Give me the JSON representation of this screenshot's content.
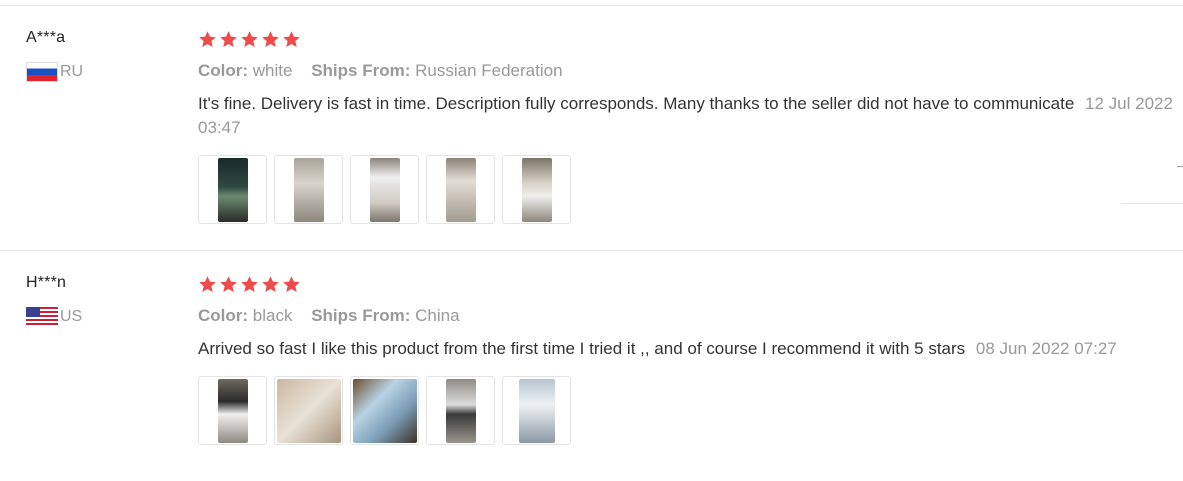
{
  "reviews": [
    {
      "user": "A***a",
      "country": "RU",
      "flag": "russia-flag",
      "rating": 5,
      "color_label": "Color:",
      "color_value": "white",
      "ships_label": "Ships From:",
      "ships_value": "Russian Federation",
      "text": "It's fine. Delivery is fast in time. Description fully corresponds. Many thanks to the seller did not have to communicate",
      "date": "12 Jul 2022 03:47",
      "photos": 5
    },
    {
      "user": "H***n",
      "country": "US",
      "flag": "usa-flag",
      "rating": 5,
      "color_label": "Color:",
      "color_value": "black",
      "ships_label": "Ships From:",
      "ships_value": "China",
      "text": "Arrived so fast I like this product from the first time I tried it ,, and of course I recommend it with 5 stars",
      "date": "08 Jun 2022 07:27",
      "photos": 5
    }
  ],
  "colors": {
    "star": "#f04b4b",
    "muted": "#999999",
    "text": "#333333"
  }
}
